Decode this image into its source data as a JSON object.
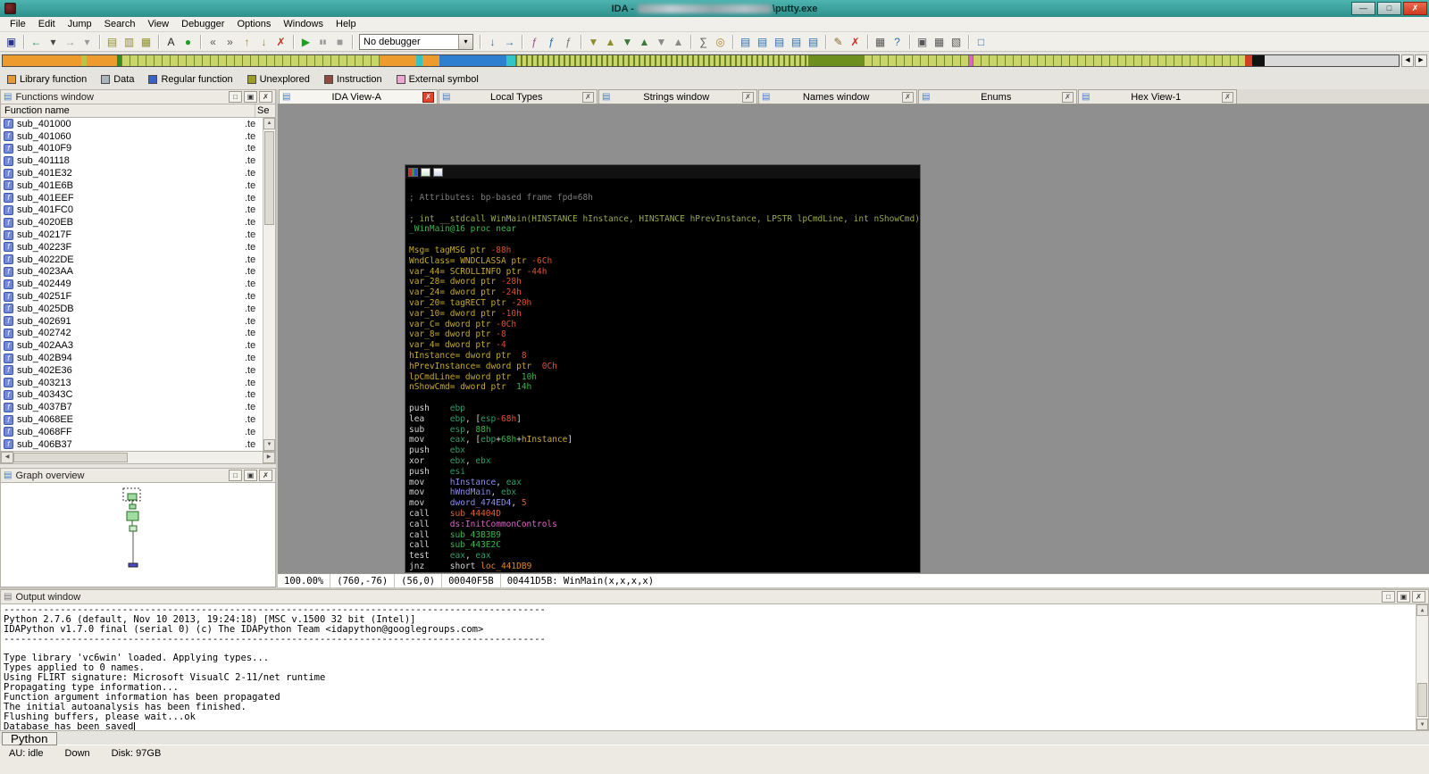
{
  "palette": {
    "cmt": "#7c7c7c",
    "proto": "#9aa84e",
    "green": "#3cb44b",
    "var": "#c9a92e",
    "neg": "#e05030",
    "mn": "#d6d6d6",
    "reg": "#2e9e6e",
    "imm": "#e0622a",
    "dat": "#8d8df0",
    "callf": "#e0622a",
    "libf": "#e064c8",
    "locf": "#e08820"
  },
  "window": {
    "title_prefix": "IDA - ",
    "title_suffix": "\\putty.exe",
    "controls": [
      {
        "n": "minimize-button",
        "g": "—"
      },
      {
        "n": "maximize-button",
        "g": "□"
      },
      {
        "n": "close-button",
        "g": "✗",
        "cls": "close"
      }
    ]
  },
  "menu": {
    "items": [
      "File",
      "Edit",
      "Jump",
      "Search",
      "View",
      "Debugger",
      "Options",
      "Windows",
      "Help"
    ]
  },
  "toolbar": {
    "no_debugger": "No debugger",
    "combo_arrow": "▾",
    "groups": [
      {
        "icons": [
          {
            "n": "save-icon",
            "g": "▣",
            "c": "#23338e"
          }
        ]
      },
      {
        "icons": [
          {
            "n": "back-icon",
            "g": "←",
            "c": "#0f8f66"
          },
          {
            "n": "back-history-dropdown-icon",
            "g": "▾",
            "c": "#444444"
          },
          {
            "n": "forward-icon",
            "g": "→",
            "c": "#9a9a9a"
          },
          {
            "n": "forward-history-dropdown-icon",
            "g": "▾",
            "c": "#9a9a9a"
          }
        ]
      },
      {
        "icons": [
          {
            "n": "jump-address-icon",
            "g": "▤",
            "c": "#8f8f2e"
          },
          {
            "n": "jump-name-icon",
            "g": "▥",
            "c": "#8f8f2e"
          },
          {
            "n": "jump-segment-icon",
            "g": "▦",
            "c": "#8f8f2e"
          }
        ]
      },
      {
        "icons": [
          {
            "n": "text-search-icon",
            "g": "A",
            "c": "#222222"
          },
          {
            "n": "binary-search-icon",
            "g": "●",
            "c": "#1f9f1f"
          }
        ]
      },
      {
        "icons": [
          {
            "n": "jump-prev-position-icon",
            "g": "«",
            "c": "#555555"
          },
          {
            "n": "jump-next-position-icon",
            "g": "»",
            "c": "#555555"
          },
          {
            "n": "prev-location-icon",
            "g": "↑",
            "c": "#8f8f2e"
          },
          {
            "n": "next-location-icon",
            "g": "↓",
            "c": "#8f8f2e"
          },
          {
            "n": "cancel-operation-icon",
            "g": "✗",
            "c": "#cc2a1a"
          }
        ]
      },
      {
        "icons": [
          {
            "n": "start-debugger-icon",
            "g": "▶",
            "c": "#1f9f1f"
          },
          {
            "n": "pause-debugger-icon",
            "g": "▮▮",
            "c": "#9a9a9a",
            "fs": 7
          },
          {
            "n": "stop-debugger-icon",
            "g": "■",
            "c": "#9a9a9a"
          }
        ]
      },
      {
        "combo": true
      },
      {
        "icons": [
          {
            "n": "step-into-icon",
            "g": "↓",
            "c": "#2a6fb0"
          },
          {
            "n": "step-over-icon",
            "g": "→",
            "c": "#2a6fb0"
          }
        ]
      },
      {
        "icons": [
          {
            "n": "create-function-icon",
            "g": "ƒ",
            "c": "#a8489a"
          },
          {
            "n": "edit-function-icon",
            "g": "ƒ",
            "c": "#2a6fb0"
          },
          {
            "n": "function-tails-icon",
            "g": "ƒ",
            "c": "#777777"
          }
        ]
      },
      {
        "icons": [
          {
            "n": "next-data-icon",
            "g": "▼",
            "c": "#8f8f2e"
          },
          {
            "n": "prev-data-icon",
            "g": "▲",
            "c": "#8f8f2e"
          },
          {
            "n": "next-code-icon",
            "g": "▼",
            "c": "#3a7a3a"
          },
          {
            "n": "prev-code-icon",
            "g": "▲",
            "c": "#3a7a3a"
          },
          {
            "n": "next-unexplored-icon",
            "g": "▼",
            "c": "#8a8a8a"
          },
          {
            "n": "prev-unexplored-icon",
            "g": "▲",
            "c": "#8a8a8a"
          }
        ]
      },
      {
        "icons": [
          {
            "n": "calculator-icon",
            "g": "∑",
            "c": "#555555"
          },
          {
            "n": "clock-icon",
            "g": "◎",
            "c": "#b0862a"
          }
        ]
      },
      {
        "icons": [
          {
            "n": "open-hexview-icon",
            "g": "▤",
            "c": "#2a6fb0"
          },
          {
            "n": "open-names-window-icon",
            "g": "▤",
            "c": "#2a6fb0"
          },
          {
            "n": "open-functions-window-icon",
            "g": "▤",
            "c": "#2a6fb0"
          },
          {
            "n": "open-strings-window-icon",
            "g": "▤",
            "c": "#2a6fb0"
          },
          {
            "n": "open-structures-icon",
            "g": "▤",
            "c": "#2a6fb0"
          }
        ]
      },
      {
        "icons": [
          {
            "n": "edit-comment-icon",
            "g": "✎",
            "c": "#8a6a2a"
          },
          {
            "n": "delete-icon",
            "g": "✗",
            "c": "#cc2a1a"
          }
        ]
      },
      {
        "icons": [
          {
            "n": "keyboard-icon",
            "g": "▦",
            "c": "#555555"
          },
          {
            "n": "help-icon",
            "g": "?",
            "c": "#2a6fb0"
          }
        ]
      },
      {
        "icons": [
          {
            "n": "windows-list-icon",
            "g": "▣",
            "c": "#555555"
          },
          {
            "n": "tile-windows-icon",
            "g": "▦",
            "c": "#555555"
          },
          {
            "n": "cascade-windows-icon",
            "g": "▧",
            "c": "#555555"
          }
        ]
      },
      {
        "icons": [
          {
            "n": "desktop-icon",
            "g": "□",
            "c": "#2a6fb0"
          }
        ]
      }
    ]
  },
  "navband": {
    "segments": [
      {
        "w": 5.6,
        "c": "#ed9b2d"
      },
      {
        "w": 0.4,
        "c": "#b8c44a"
      },
      {
        "w": 2.2,
        "c": "#ed9b2d"
      },
      {
        "w": 0.3,
        "c": "#2e8b2e"
      },
      {
        "w": 18.5,
        "c": "#c9d469",
        "t": "sparse"
      },
      {
        "w": 2.6,
        "c": "#ed9b2d"
      },
      {
        "w": 0.5,
        "c": "#35c4c4"
      },
      {
        "w": 1.2,
        "c": "#ed9b2d"
      },
      {
        "w": 4.8,
        "c": "#2f7fd0"
      },
      {
        "w": 0.6,
        "c": "#35c4c4"
      },
      {
        "w": 21.0,
        "c": "#c9d469",
        "t": "dense"
      },
      {
        "w": 4.0,
        "c": "#6d8f1e"
      },
      {
        "w": 7.5,
        "c": "#c9d469",
        "t": "sparse"
      },
      {
        "w": 0.3,
        "c": "#e260c8"
      },
      {
        "w": 19.5,
        "c": "#c9d469",
        "t": "sparse"
      },
      {
        "w": 0.5,
        "c": "#d04020"
      },
      {
        "w": 0.9,
        "c": "#111111"
      },
      {
        "w": 9.6,
        "c": "#d9d9d9"
      }
    ],
    "arrows": {
      "left": "◀",
      "right": "▶"
    },
    "legend": [
      {
        "label": "Library function",
        "color": "#e8973a"
      },
      {
        "label": "Data",
        "color": "#aab4be"
      },
      {
        "label": "Regular function",
        "color": "#3a62c8"
      },
      {
        "label": "Unexplored",
        "color": "#9c9c28"
      },
      {
        "label": "Instruction",
        "color": "#8f4a42"
      },
      {
        "label": "External symbol",
        "color": "#efa6d2"
      }
    ]
  },
  "tabs": {
    "close_glyph": "✗",
    "icon_glyph": "▤",
    "items": [
      {
        "label": "IDA View-A",
        "active": true
      },
      {
        "label": "Local Types",
        "active": false
      },
      {
        "label": "Strings window",
        "active": false
      },
      {
        "label": "Names window",
        "active": false
      },
      {
        "label": "Enums",
        "active": false
      },
      {
        "label": "Hex View-1",
        "active": false
      }
    ]
  },
  "functions_panel": {
    "title": "Functions window",
    "col_name": "Function name",
    "col_seg": "Se",
    "icon_glyph": "f",
    "functions": [
      {
        "name": "sub_401000",
        "seg": ".te"
      },
      {
        "name": "sub_401060",
        "seg": ".te"
      },
      {
        "name": "sub_4010F9",
        "seg": ".te"
      },
      {
        "name": "sub_401118",
        "seg": ".te"
      },
      {
        "name": "sub_401E32",
        "seg": ".te"
      },
      {
        "name": "sub_401E6B",
        "seg": ".te"
      },
      {
        "name": "sub_401EEF",
        "seg": ".te"
      },
      {
        "name": "sub_401FC0",
        "seg": ".te"
      },
      {
        "name": "sub_4020EB",
        "seg": ".te"
      },
      {
        "name": "sub_40217F",
        "seg": ".te"
      },
      {
        "name": "sub_40223F",
        "seg": ".te"
      },
      {
        "name": "sub_4022DE",
        "seg": ".te"
      },
      {
        "name": "sub_4023AA",
        "seg": ".te"
      },
      {
        "name": "sub_402449",
        "seg": ".te"
      },
      {
        "name": "sub_40251F",
        "seg": ".te"
      },
      {
        "name": "sub_4025DB",
        "seg": ".te"
      },
      {
        "name": "sub_402691",
        "seg": ".te"
      },
      {
        "name": "sub_402742",
        "seg": ".te"
      },
      {
        "name": "sub_402AA3",
        "seg": ".te"
      },
      {
        "name": "sub_402B94",
        "seg": ".te"
      },
      {
        "name": "sub_402E36",
        "seg": ".te"
      },
      {
        "name": "sub_403213",
        "seg": ".te"
      },
      {
        "name": "sub_40343C",
        "seg": ".te"
      },
      {
        "name": "sub_4037B7",
        "seg": ".te"
      },
      {
        "name": "sub_4068EE",
        "seg": ".te"
      },
      {
        "name": "sub_4068FF",
        "seg": ".te"
      },
      {
        "name": "sub_406B37",
        "seg": ".te"
      }
    ]
  },
  "graph_overview": {
    "title": "Graph overview"
  },
  "disasm": {
    "status_cells": [
      "100.00%",
      "(760,-76)",
      "(56,0)",
      "00040F5B",
      "00441D5B: WinMain(x,x,x,x)"
    ],
    "lines": [
      [
        [
          "; Attributes: bp-based frame fpd=68h",
          "cmt"
        ]
      ],
      [],
      [
        [
          "; int __stdcall WinMain(HINSTANCE hInstance, HINSTANCE hPrevInstance, LPSTR lpCmdLine, int nShowCmd)",
          "proto"
        ]
      ],
      [
        [
          "_WinMain@16 proc near",
          "pname"
        ]
      ],
      [],
      [
        [
          "Msg= tagMSG ptr ",
          "var"
        ],
        [
          "-88h",
          "neg"
        ]
      ],
      [
        [
          "WndClass= WNDCLASSA ptr ",
          "var"
        ],
        [
          "-6Ch",
          "neg"
        ]
      ],
      [
        [
          "var_44= SCROLLINFO ptr ",
          "var"
        ],
        [
          "-44h",
          "neg"
        ]
      ],
      [
        [
          "var_28= dword ptr ",
          "var"
        ],
        [
          "-28h",
          "neg"
        ]
      ],
      [
        [
          "var_24= dword ptr ",
          "var"
        ],
        [
          "-24h",
          "neg"
        ]
      ],
      [
        [
          "var_20= tagRECT ptr ",
          "var"
        ],
        [
          "-20h",
          "neg"
        ]
      ],
      [
        [
          "var_10= dword ptr ",
          "var"
        ],
        [
          "-10h",
          "neg"
        ]
      ],
      [
        [
          "var_C= dword ptr ",
          "var"
        ],
        [
          "-0Ch",
          "neg"
        ]
      ],
      [
        [
          "var_8= dword ptr ",
          "var"
        ],
        [
          "-8",
          "neg"
        ]
      ],
      [
        [
          "var_4= dword ptr ",
          "var"
        ],
        [
          "-4",
          "neg"
        ]
      ],
      [
        [
          "hInstance= dword ptr  ",
          "var"
        ],
        [
          "8",
          "neg"
        ]
      ],
      [
        [
          "hPrevInstance= dword ptr  ",
          "var"
        ],
        [
          "0Ch",
          "neg"
        ]
      ],
      [
        [
          "lpCmdLine= dword ptr  ",
          "var"
        ],
        [
          "10h",
          "pos"
        ]
      ],
      [
        [
          "nShowCmd= dword ptr  ",
          "var"
        ],
        [
          "14h",
          "pos"
        ]
      ],
      [],
      [
        [
          "push    ",
          "mn"
        ],
        [
          "ebp",
          "reg"
        ]
      ],
      [
        [
          "lea     ",
          "mn"
        ],
        [
          "ebp",
          "reg"
        ],
        [
          ", [",
          "mn"
        ],
        [
          "esp",
          "reg"
        ],
        [
          "-68h",
          "neg"
        ],
        [
          "]",
          "mn"
        ]
      ],
      [
        [
          "sub     ",
          "mn"
        ],
        [
          "esp",
          "reg"
        ],
        [
          ", ",
          "mn"
        ],
        [
          "88h",
          "num"
        ]
      ],
      [
        [
          "mov     ",
          "mn"
        ],
        [
          "eax",
          "reg"
        ],
        [
          ", [",
          "mn"
        ],
        [
          "ebp",
          "reg"
        ],
        [
          "+",
          "mn"
        ],
        [
          "68h",
          "num"
        ],
        [
          "+",
          "mn"
        ],
        [
          "hInstance",
          "var"
        ],
        [
          "]",
          "mn"
        ]
      ],
      [
        [
          "push    ",
          "mn"
        ],
        [
          "ebx",
          "reg"
        ]
      ],
      [
        [
          "xor     ",
          "mn"
        ],
        [
          "ebx",
          "reg"
        ],
        [
          ", ",
          "mn"
        ],
        [
          "ebx",
          "reg"
        ]
      ],
      [
        [
          "push    ",
          "mn"
        ],
        [
          "esi",
          "reg"
        ]
      ],
      [
        [
          "mov     ",
          "mn"
        ],
        [
          "hInstance",
          "dat"
        ],
        [
          ", ",
          "mn"
        ],
        [
          "eax",
          "reg"
        ]
      ],
      [
        [
          "mov     ",
          "mn"
        ],
        [
          "hWndMain",
          "dat"
        ],
        [
          ", ",
          "mn"
        ],
        [
          "ebx",
          "reg"
        ]
      ],
      [
        [
          "mov     ",
          "mn"
        ],
        [
          "dword_474ED4",
          "dat"
        ],
        [
          ", ",
          "mn"
        ],
        [
          "5",
          "imm"
        ]
      ],
      [
        [
          "call    ",
          "mn"
        ],
        [
          "sub_44404D",
          "callf"
        ]
      ],
      [
        [
          "call    ",
          "mn"
        ],
        [
          "ds:InitCommonControls",
          "libf"
        ]
      ],
      [
        [
          "call    ",
          "mn"
        ],
        [
          "sub_43B3B9",
          "pname"
        ]
      ],
      [
        [
          "call    ",
          "mn"
        ],
        [
          "sub_443E2C",
          "pname"
        ]
      ],
      [
        [
          "test    ",
          "mn"
        ],
        [
          "eax",
          "reg"
        ],
        [
          ", ",
          "mn"
        ],
        [
          "eax",
          "reg"
        ]
      ],
      [
        [
          "jnz     ",
          "mn"
        ],
        [
          "short ",
          "mn"
        ],
        [
          "loc_441DB9",
          "locf"
        ]
      ]
    ]
  },
  "output": {
    "title": "Output window",
    "python_button": "Python",
    "caret_line_index": 12,
    "lines": [
      "------------------------------------------------------------------------------------------------",
      "Python 2.7.6 (default, Nov 10 2013, 19:24:18) [MSC v.1500 32 bit (Intel)]",
      "IDAPython v1.7.0 final (serial 0) (c) The IDAPython Team <idapython@googlegroups.com>",
      "------------------------------------------------------------------------------------------------",
      "",
      "Type library 'vc6win' loaded. Applying types...",
      "Types applied to 0 names.",
      "Using FLIRT signature: Microsoft VisualC 2-11/net runtime",
      "Propagating type information...",
      "Function argument information has been propagated",
      "The initial autoanalysis has been finished.",
      "Flushing buffers, please wait...ok",
      "Database has been saved"
    ]
  },
  "statusbar": {
    "au": "AU: idle",
    "down": "Down",
    "disk": "Disk: 97GB"
  },
  "ui": {
    "panel_icon": "▤",
    "panel_buttons": [
      {
        "n": "float-panel-button",
        "g": "□"
      },
      {
        "n": "maximize-panel-button",
        "g": "▣"
      },
      {
        "n": "close-panel-button",
        "g": "✗"
      }
    ],
    "scroll": {
      "up": "▲",
      "down": "▼",
      "left": "◀",
      "right": "▶"
    }
  }
}
